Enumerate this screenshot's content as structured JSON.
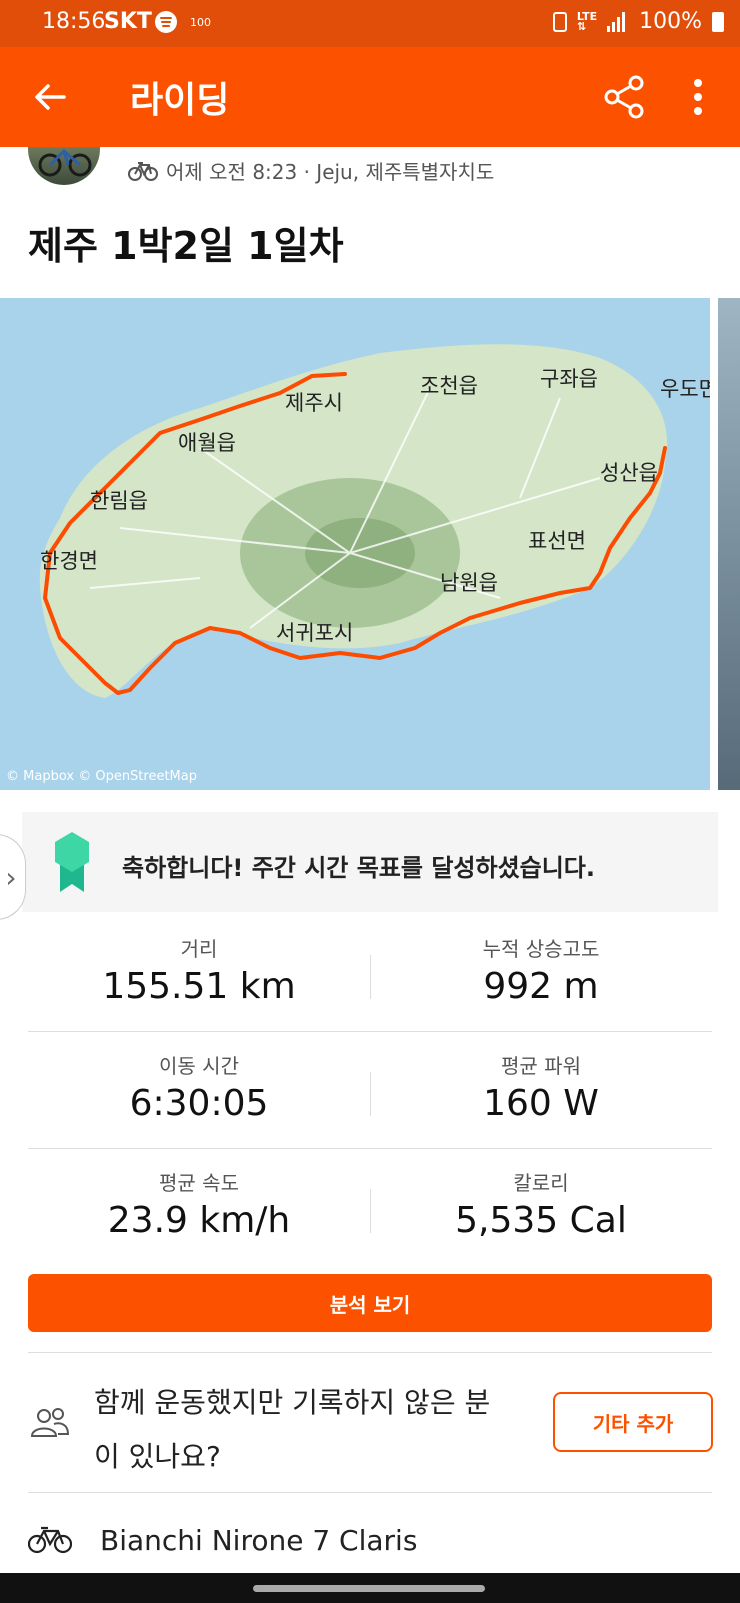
{
  "status_bar": {
    "time": "18:56",
    "carrier": "SKT",
    "small": "100",
    "battery": "100%"
  },
  "appbar": {
    "title": "라이딩"
  },
  "activity": {
    "meta": "어제 오전 8:23 · Jeju, 제주특별자치도",
    "title": "제주 1박2일 1일차"
  },
  "map": {
    "attribution": "© Mapbox © OpenStreetMap",
    "places": [
      "제주시",
      "조천읍",
      "구좌읍",
      "우도면",
      "애월읍",
      "한림읍",
      "성산읍",
      "한경면",
      "표선면",
      "남원읍",
      "서귀포시"
    ]
  },
  "achievement": {
    "text": "축하합니다! 주간 시간 목표를 달성하셨습니다."
  },
  "stats": [
    {
      "label": "거리",
      "value": "155.51 km"
    },
    {
      "label": "누적 상승고도",
      "value": "992 m"
    },
    {
      "label": "이동 시간",
      "value": "6:30:05"
    },
    {
      "label": "평균 파워",
      "value": "160 W"
    },
    {
      "label": "평균 속도",
      "value": "23.9 km/h"
    },
    {
      "label": "칼로리",
      "value": "5,535 Cal"
    }
  ],
  "analyze_label": "분석 보기",
  "together": {
    "text": "함께 운동했지만 기록하지 않은 분이 있나요?",
    "button": "기타 추가"
  },
  "gear": {
    "name": "Bianchi Nirone 7 Claris"
  },
  "colors": {
    "brand": "#fc5200",
    "status": "#e14e0a"
  }
}
